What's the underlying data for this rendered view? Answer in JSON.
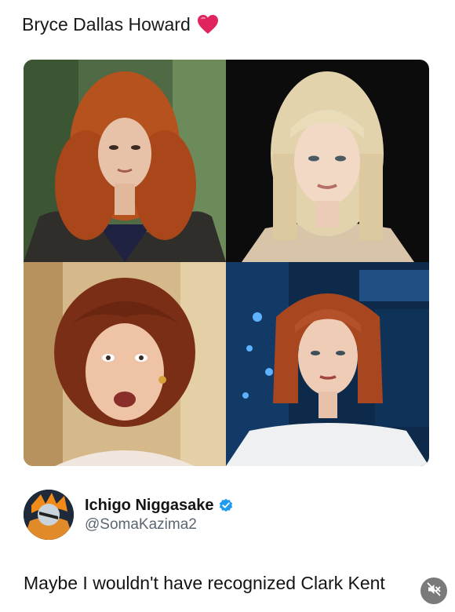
{
  "post": {
    "caption": "Bryce Dallas Howard",
    "heart_icon": "red-heart-emoji"
  },
  "photo_grid": {
    "cells": [
      {
        "name": "photo-top-left",
        "hair_color": "#b5521e"
      },
      {
        "name": "photo-top-right",
        "hair_color": "#e3d3ad"
      },
      {
        "name": "photo-bottom-left",
        "hair_color": "#7a2e16"
      },
      {
        "name": "photo-bottom-right",
        "hair_color": "#a84620"
      }
    ]
  },
  "tweet": {
    "display_name": "Ichigo Niggasake",
    "handle": "@SomaKazima2",
    "verified": true,
    "verified_color": "#1d9bf0",
    "text": "Maybe I wouldn't have recognized Clark Kent"
  },
  "controls": {
    "mute_icon": "muted-speaker-icon"
  }
}
